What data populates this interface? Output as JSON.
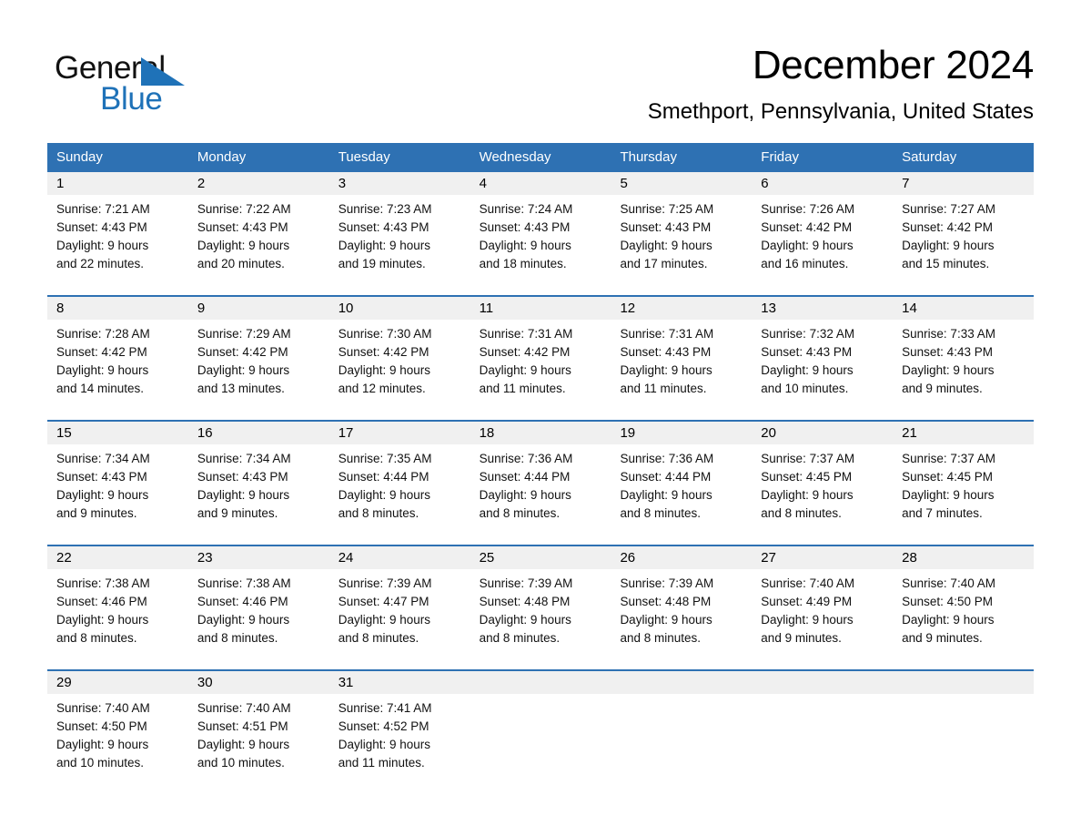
{
  "brand": {
    "name_top": "General",
    "name_bottom": "Blue",
    "triangle_color": "#1f72b8"
  },
  "header": {
    "title": "December 2024",
    "subtitle": "Smethport, Pennsylvania, United States"
  },
  "theme": {
    "header_blue": "#2e71b3",
    "day_band_gray": "#f0f0f0",
    "text_black": "#111111"
  },
  "weekdays": [
    "Sunday",
    "Monday",
    "Tuesday",
    "Wednesday",
    "Thursday",
    "Friday",
    "Saturday"
  ],
  "weeks": [
    [
      {
        "day": "1",
        "sunrise": "Sunrise: 7:21 AM",
        "sunset": "Sunset: 4:43 PM",
        "daylight1": "Daylight: 9 hours",
        "daylight2": "and 22 minutes."
      },
      {
        "day": "2",
        "sunrise": "Sunrise: 7:22 AM",
        "sunset": "Sunset: 4:43 PM",
        "daylight1": "Daylight: 9 hours",
        "daylight2": "and 20 minutes."
      },
      {
        "day": "3",
        "sunrise": "Sunrise: 7:23 AM",
        "sunset": "Sunset: 4:43 PM",
        "daylight1": "Daylight: 9 hours",
        "daylight2": "and 19 minutes."
      },
      {
        "day": "4",
        "sunrise": "Sunrise: 7:24 AM",
        "sunset": "Sunset: 4:43 PM",
        "daylight1": "Daylight: 9 hours",
        "daylight2": "and 18 minutes."
      },
      {
        "day": "5",
        "sunrise": "Sunrise: 7:25 AM",
        "sunset": "Sunset: 4:43 PM",
        "daylight1": "Daylight: 9 hours",
        "daylight2": "and 17 minutes."
      },
      {
        "day": "6",
        "sunrise": "Sunrise: 7:26 AM",
        "sunset": "Sunset: 4:42 PM",
        "daylight1": "Daylight: 9 hours",
        "daylight2": "and 16 minutes."
      },
      {
        "day": "7",
        "sunrise": "Sunrise: 7:27 AM",
        "sunset": "Sunset: 4:42 PM",
        "daylight1": "Daylight: 9 hours",
        "daylight2": "and 15 minutes."
      }
    ],
    [
      {
        "day": "8",
        "sunrise": "Sunrise: 7:28 AM",
        "sunset": "Sunset: 4:42 PM",
        "daylight1": "Daylight: 9 hours",
        "daylight2": "and 14 minutes."
      },
      {
        "day": "9",
        "sunrise": "Sunrise: 7:29 AM",
        "sunset": "Sunset: 4:42 PM",
        "daylight1": "Daylight: 9 hours",
        "daylight2": "and 13 minutes."
      },
      {
        "day": "10",
        "sunrise": "Sunrise: 7:30 AM",
        "sunset": "Sunset: 4:42 PM",
        "daylight1": "Daylight: 9 hours",
        "daylight2": "and 12 minutes."
      },
      {
        "day": "11",
        "sunrise": "Sunrise: 7:31 AM",
        "sunset": "Sunset: 4:42 PM",
        "daylight1": "Daylight: 9 hours",
        "daylight2": "and 11 minutes."
      },
      {
        "day": "12",
        "sunrise": "Sunrise: 7:31 AM",
        "sunset": "Sunset: 4:43 PM",
        "daylight1": "Daylight: 9 hours",
        "daylight2": "and 11 minutes."
      },
      {
        "day": "13",
        "sunrise": "Sunrise: 7:32 AM",
        "sunset": "Sunset: 4:43 PM",
        "daylight1": "Daylight: 9 hours",
        "daylight2": "and 10 minutes."
      },
      {
        "day": "14",
        "sunrise": "Sunrise: 7:33 AM",
        "sunset": "Sunset: 4:43 PM",
        "daylight1": "Daylight: 9 hours",
        "daylight2": "and 9 minutes."
      }
    ],
    [
      {
        "day": "15",
        "sunrise": "Sunrise: 7:34 AM",
        "sunset": "Sunset: 4:43 PM",
        "daylight1": "Daylight: 9 hours",
        "daylight2": "and 9 minutes."
      },
      {
        "day": "16",
        "sunrise": "Sunrise: 7:34 AM",
        "sunset": "Sunset: 4:43 PM",
        "daylight1": "Daylight: 9 hours",
        "daylight2": "and 9 minutes."
      },
      {
        "day": "17",
        "sunrise": "Sunrise: 7:35 AM",
        "sunset": "Sunset: 4:44 PM",
        "daylight1": "Daylight: 9 hours",
        "daylight2": "and 8 minutes."
      },
      {
        "day": "18",
        "sunrise": "Sunrise: 7:36 AM",
        "sunset": "Sunset: 4:44 PM",
        "daylight1": "Daylight: 9 hours",
        "daylight2": "and 8 minutes."
      },
      {
        "day": "19",
        "sunrise": "Sunrise: 7:36 AM",
        "sunset": "Sunset: 4:44 PM",
        "daylight1": "Daylight: 9 hours",
        "daylight2": "and 8 minutes."
      },
      {
        "day": "20",
        "sunrise": "Sunrise: 7:37 AM",
        "sunset": "Sunset: 4:45 PM",
        "daylight1": "Daylight: 9 hours",
        "daylight2": "and 8 minutes."
      },
      {
        "day": "21",
        "sunrise": "Sunrise: 7:37 AM",
        "sunset": "Sunset: 4:45 PM",
        "daylight1": "Daylight: 9 hours",
        "daylight2": "and 7 minutes."
      }
    ],
    [
      {
        "day": "22",
        "sunrise": "Sunrise: 7:38 AM",
        "sunset": "Sunset: 4:46 PM",
        "daylight1": "Daylight: 9 hours",
        "daylight2": "and 8 minutes."
      },
      {
        "day": "23",
        "sunrise": "Sunrise: 7:38 AM",
        "sunset": "Sunset: 4:46 PM",
        "daylight1": "Daylight: 9 hours",
        "daylight2": "and 8 minutes."
      },
      {
        "day": "24",
        "sunrise": "Sunrise: 7:39 AM",
        "sunset": "Sunset: 4:47 PM",
        "daylight1": "Daylight: 9 hours",
        "daylight2": "and 8 minutes."
      },
      {
        "day": "25",
        "sunrise": "Sunrise: 7:39 AM",
        "sunset": "Sunset: 4:48 PM",
        "daylight1": "Daylight: 9 hours",
        "daylight2": "and 8 minutes."
      },
      {
        "day": "26",
        "sunrise": "Sunrise: 7:39 AM",
        "sunset": "Sunset: 4:48 PM",
        "daylight1": "Daylight: 9 hours",
        "daylight2": "and 8 minutes."
      },
      {
        "day": "27",
        "sunrise": "Sunrise: 7:40 AM",
        "sunset": "Sunset: 4:49 PM",
        "daylight1": "Daylight: 9 hours",
        "daylight2": "and 9 minutes."
      },
      {
        "day": "28",
        "sunrise": "Sunrise: 7:40 AM",
        "sunset": "Sunset: 4:50 PM",
        "daylight1": "Daylight: 9 hours",
        "daylight2": "and 9 minutes."
      }
    ],
    [
      {
        "day": "29",
        "sunrise": "Sunrise: 7:40 AM",
        "sunset": "Sunset: 4:50 PM",
        "daylight1": "Daylight: 9 hours",
        "daylight2": "and 10 minutes."
      },
      {
        "day": "30",
        "sunrise": "Sunrise: 7:40 AM",
        "sunset": "Sunset: 4:51 PM",
        "daylight1": "Daylight: 9 hours",
        "daylight2": "and 10 minutes."
      },
      {
        "day": "31",
        "sunrise": "Sunrise: 7:41 AM",
        "sunset": "Sunset: 4:52 PM",
        "daylight1": "Daylight: 9 hours",
        "daylight2": "and 11 minutes."
      },
      {
        "day": "",
        "sunrise": "",
        "sunset": "",
        "daylight1": "",
        "daylight2": ""
      },
      {
        "day": "",
        "sunrise": "",
        "sunset": "",
        "daylight1": "",
        "daylight2": ""
      },
      {
        "day": "",
        "sunrise": "",
        "sunset": "",
        "daylight1": "",
        "daylight2": ""
      },
      {
        "day": "",
        "sunrise": "",
        "sunset": "",
        "daylight1": "",
        "daylight2": ""
      }
    ]
  ]
}
